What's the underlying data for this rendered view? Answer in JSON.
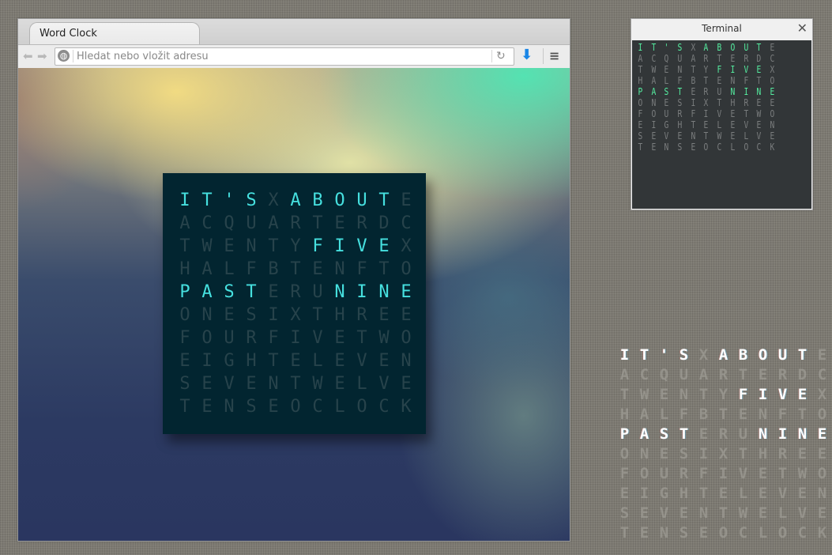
{
  "browser": {
    "tab_title": "Word Clock",
    "url_placeholder": "Hledat nebo vložit adresu",
    "url_value": "",
    "icons": {
      "back": "arrow-left-icon",
      "forward": "arrow-right-icon",
      "site": "globe-icon",
      "reload": "reload-icon",
      "download": "download-arrow-icon",
      "menu": "hamburger-menu-icon"
    },
    "glyphs": {
      "back": "⬅",
      "forward": "➡",
      "site": "◍",
      "reload": "↻",
      "download": "⬇",
      "menu": "≡"
    }
  },
  "terminal": {
    "title": "Terminal",
    "close_glyph": "✕"
  },
  "clock": {
    "time_phrase": "IT'S ABOUT FIVE PAST NINE",
    "rows": [
      "IT'SXABOUTE",
      "ACQUARTERDC",
      "TWENTYFIVEX",
      "HALFBTENFTO",
      "PASTERUNINE",
      "ONESIXTHREE",
      "FOURFIVETWO",
      "EIGHTELEVEN",
      "SEVENTWELVE",
      "TENSEOCLOCK"
    ],
    "lit": [
      [
        0,
        0,
        4
      ],
      [
        0,
        5,
        10
      ],
      [
        2,
        6,
        10
      ],
      [
        4,
        0,
        4
      ],
      [
        4,
        7,
        11
      ]
    ]
  },
  "colors": {
    "browser_clock_lit": "#46e0df",
    "browser_clock_dim": "#27434b",
    "browser_clock_bg": "#022530",
    "terminal_lit": "#55eea0",
    "terminal_dim": "#7a7d7e",
    "terminal_bg": "#323638",
    "desktop_lit": "#ffffff",
    "download_icon": "#1a86e6"
  }
}
